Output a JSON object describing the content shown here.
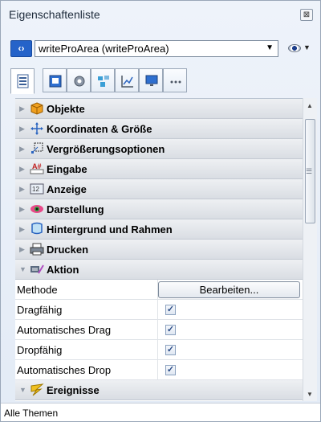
{
  "window": {
    "title": "Eigenschaftenliste",
    "close_label": "⊠"
  },
  "selector": {
    "value": "writeProArea (writeProArea)"
  },
  "tabs": [
    {
      "icon": "list-icon",
      "active": true
    },
    {
      "icon": "object-icon"
    },
    {
      "icon": "gear-icon"
    },
    {
      "icon": "layout-icon"
    },
    {
      "icon": "chart-icon"
    },
    {
      "icon": "monitor-icon"
    },
    {
      "icon": "more-icon"
    }
  ],
  "groups": [
    {
      "label": "Objekte",
      "icon": "cube-icon",
      "expanded": false
    },
    {
      "label": "Koordinaten & Größe",
      "icon": "move-icon",
      "expanded": false
    },
    {
      "label": "Vergrößerungsoptionen",
      "icon": "resize-icon",
      "expanded": false
    },
    {
      "label": "Eingabe",
      "icon": "input-icon",
      "expanded": false
    },
    {
      "label": "Anzeige",
      "icon": "display-icon",
      "expanded": false
    },
    {
      "label": "Darstellung",
      "icon": "eye-icon",
      "expanded": false
    },
    {
      "label": "Hintergrund und Rahmen",
      "icon": "border-icon",
      "expanded": false
    },
    {
      "label": "Drucken",
      "icon": "printer-icon",
      "expanded": false
    },
    {
      "label": "Aktion",
      "icon": "action-icon",
      "expanded": true
    }
  ],
  "action_props": {
    "method_label": "Methode",
    "edit_button": "Bearbeiten...",
    "rows": [
      {
        "label": "Dragfähig",
        "checked": true
      },
      {
        "label": "Automatisches Drag",
        "checked": true
      },
      {
        "label": "Dropfähig",
        "checked": true
      },
      {
        "label": "Automatisches Drop",
        "checked": true
      }
    ]
  },
  "events_group": {
    "label": "Ereignisse",
    "icon": "lightning-icon",
    "expanded": true
  },
  "status": {
    "text": "Alle Themen"
  },
  "colors": {
    "accent": "#2563c9",
    "panel_bg": "#e3ebf6"
  }
}
